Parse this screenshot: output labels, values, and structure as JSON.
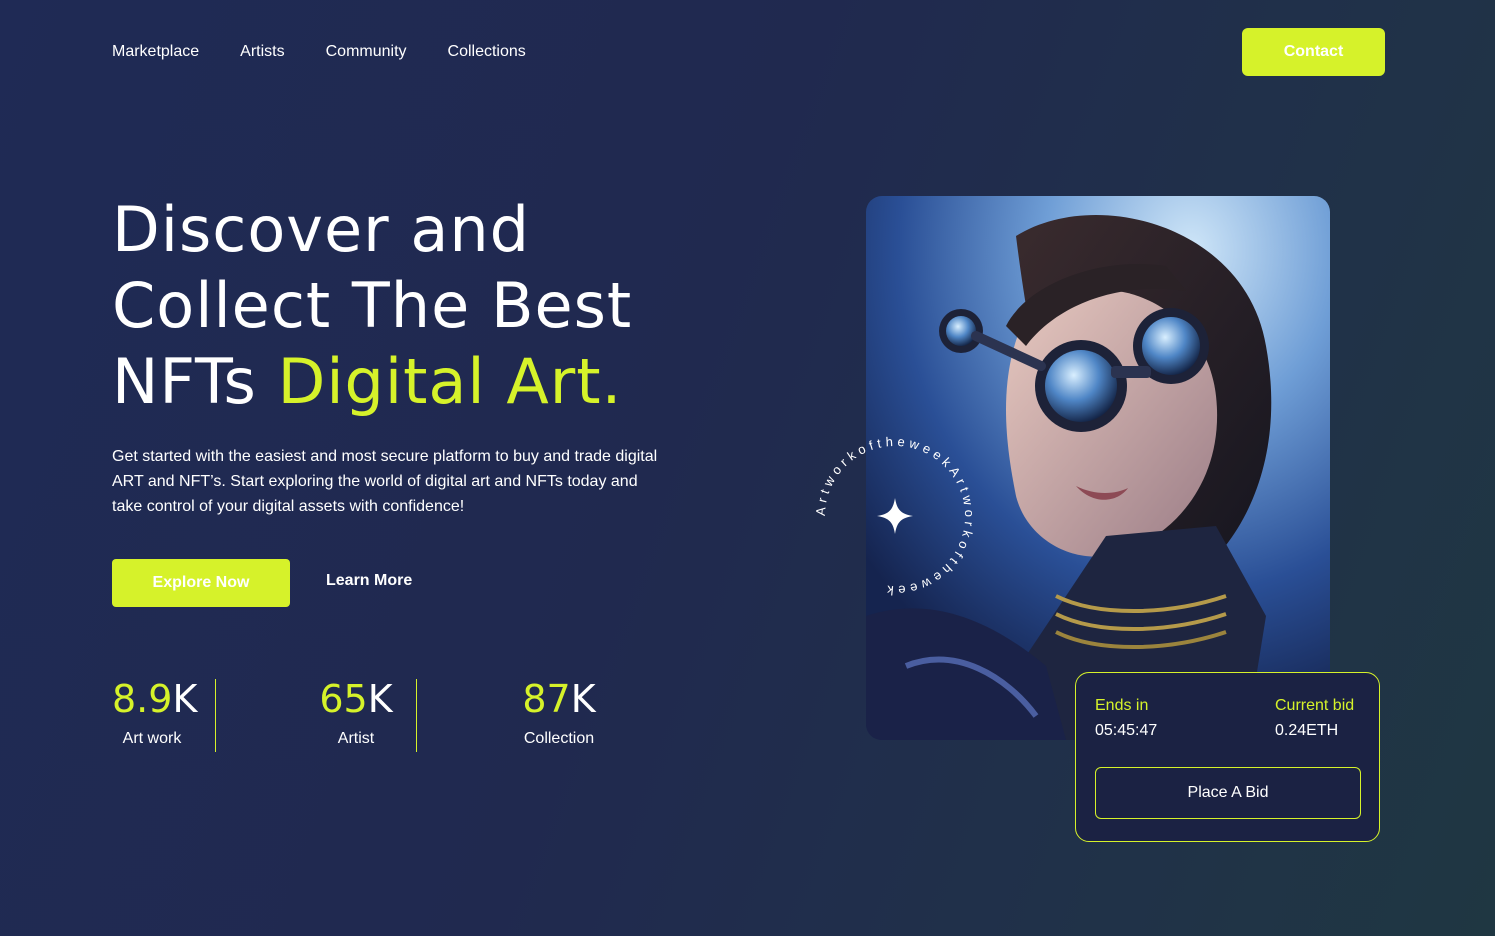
{
  "nav": {
    "items": [
      {
        "label": "Marketplace"
      },
      {
        "label": "Artists"
      },
      {
        "label": "Community"
      },
      {
        "label": "Collections"
      }
    ],
    "contact_label": "Contact"
  },
  "hero": {
    "line1": "Discover and",
    "line2": "Collect The Best",
    "line3_plain": "NFTs ",
    "line3_accent": "Digital Art.",
    "description": "Get started with the easiest and most secure platform to buy and trade digital ART and NFT’s. Start exploring the world of digital art and NFTs today and take control of your digital assets with confidence!",
    "primary_cta": "Explore Now",
    "secondary_cta": "Learn More"
  },
  "stats": [
    {
      "value": "8.9",
      "suffix": "K",
      "label": "Art work"
    },
    {
      "value": "65",
      "suffix": "K",
      "label": "Artist"
    },
    {
      "value": "87",
      "suffix": "K",
      "label": "Collection"
    }
  ],
  "badge": {
    "text": "ArtworkoftheweekArtworkoftheweek"
  },
  "auction": {
    "ends_label": "Ends in",
    "ends_value": "05:45:47",
    "bid_label": "Current bid",
    "bid_value": "0.24ETH",
    "bid_button": "Place A Bid"
  },
  "colors": {
    "accent": "#d6f22a",
    "background": "#1f2a55",
    "card": "#1b2243"
  }
}
